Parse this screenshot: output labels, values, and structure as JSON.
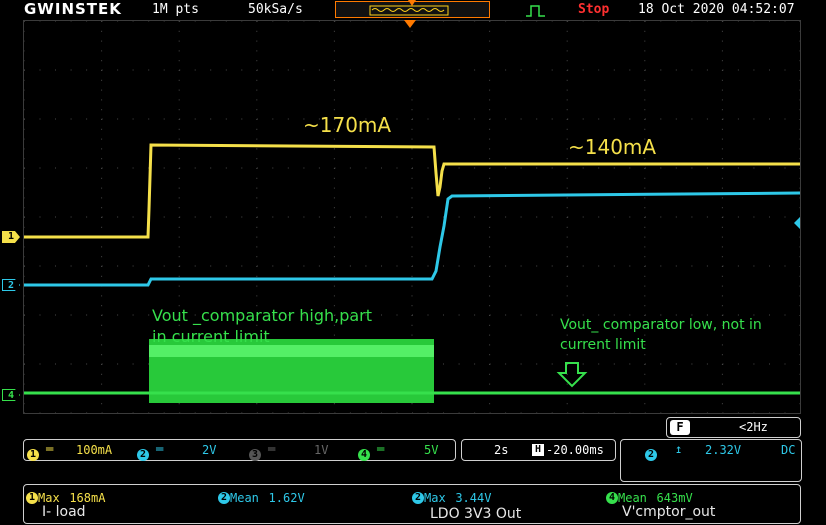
{
  "header": {
    "brand": "GWINSTEK",
    "record_length": "1M pts",
    "sample_rate": "50kSa/s",
    "run_state": "Stop",
    "datetime": "18 Oct 2020 04:52:07",
    "trigger_icon": "rising-edge-trigger-icon"
  },
  "annotations": {
    "current_high": "~170mA",
    "current_low": "~140mA",
    "comparator_high_line1": "Vout _comparator  high,part",
    "comparator_high_line2": "in current limit",
    "comparator_low_line1": "Vout_ comparator low, not in",
    "comparator_low_line2": "current limit"
  },
  "channels": {
    "ch1": {
      "marker": "1",
      "color": "#f5e04a",
      "scale": "100mA"
    },
    "ch2": {
      "marker": "2",
      "color": "#2ec8e8",
      "scale": "2V"
    },
    "ch3": {
      "marker": "3",
      "color": "#666666",
      "scale": "1V"
    },
    "ch4": {
      "marker": "4",
      "color": "#36e04c",
      "scale": "5V"
    }
  },
  "timebase": {
    "scale": "2s",
    "offset": "-20.00ms"
  },
  "trigger": {
    "channel": "2",
    "level": "2.32V",
    "coupling": "DC",
    "frequency": "<2Hz",
    "label": "F"
  },
  "measurements": [
    {
      "channel": "1",
      "label": "Max",
      "value": "168mA",
      "name": "I- load"
    },
    {
      "channel": "2",
      "label": "Mean",
      "value": "1.62V",
      "name": ""
    },
    {
      "channel": "2",
      "label": "Max",
      "value": "3.44V",
      "name": "LDO 3V3 Out"
    },
    {
      "channel": "4",
      "label": "Mean",
      "value": "643mV",
      "name": "V'cmptor_out"
    }
  ]
}
